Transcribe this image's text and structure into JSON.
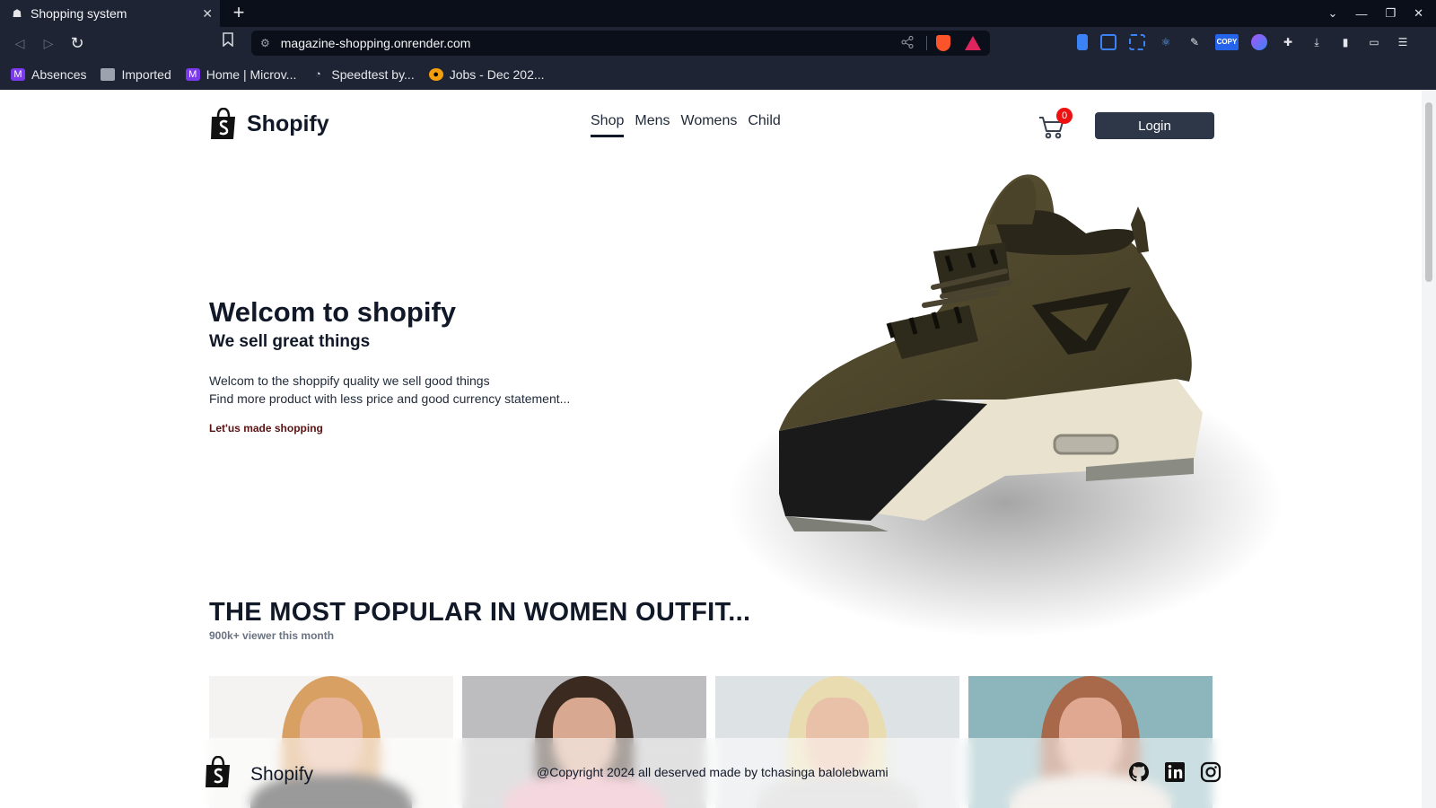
{
  "browser": {
    "tab_title": "Shopping system",
    "url": "magazine-shopping.onrender.com",
    "bookmarks": [
      {
        "label": "Absences",
        "icon": "microvision-icon"
      },
      {
        "label": "Imported",
        "icon": "folder-icon"
      },
      {
        "label": "Home | Microv...",
        "icon": "microvision-icon"
      },
      {
        "label": "Speedtest by...",
        "icon": "speedtest-icon"
      },
      {
        "label": "Jobs - Dec 202...",
        "icon": "jobs-icon"
      }
    ],
    "copy_ext_label": "COPY"
  },
  "site": {
    "brand": "Shopify",
    "nav": [
      "Shop",
      "Mens",
      "Womens",
      "Child"
    ],
    "active_nav": "Shop",
    "cart_count": "0",
    "login_label": "Login"
  },
  "hero": {
    "title": "Welcom to shopify",
    "subtitle": "We sell great things",
    "line1": "Welcom to the shoppify quality we sell good things",
    "line2": "Find more product with less price and good currency statement...",
    "cta": "Let'us made shopping"
  },
  "popular": {
    "heading": "THE MOST POPULAR IN WOMEN OUTFIT...",
    "subheading": "900k+ viewer this month"
  },
  "footer": {
    "brand": "Shopify",
    "copyright": "@Copyright 2024 all deserved made by tchasinga balolebwami"
  },
  "colors": {
    "primary_button": "#2d3748",
    "badge": "#ef1111",
    "cta": "#5b1212"
  }
}
